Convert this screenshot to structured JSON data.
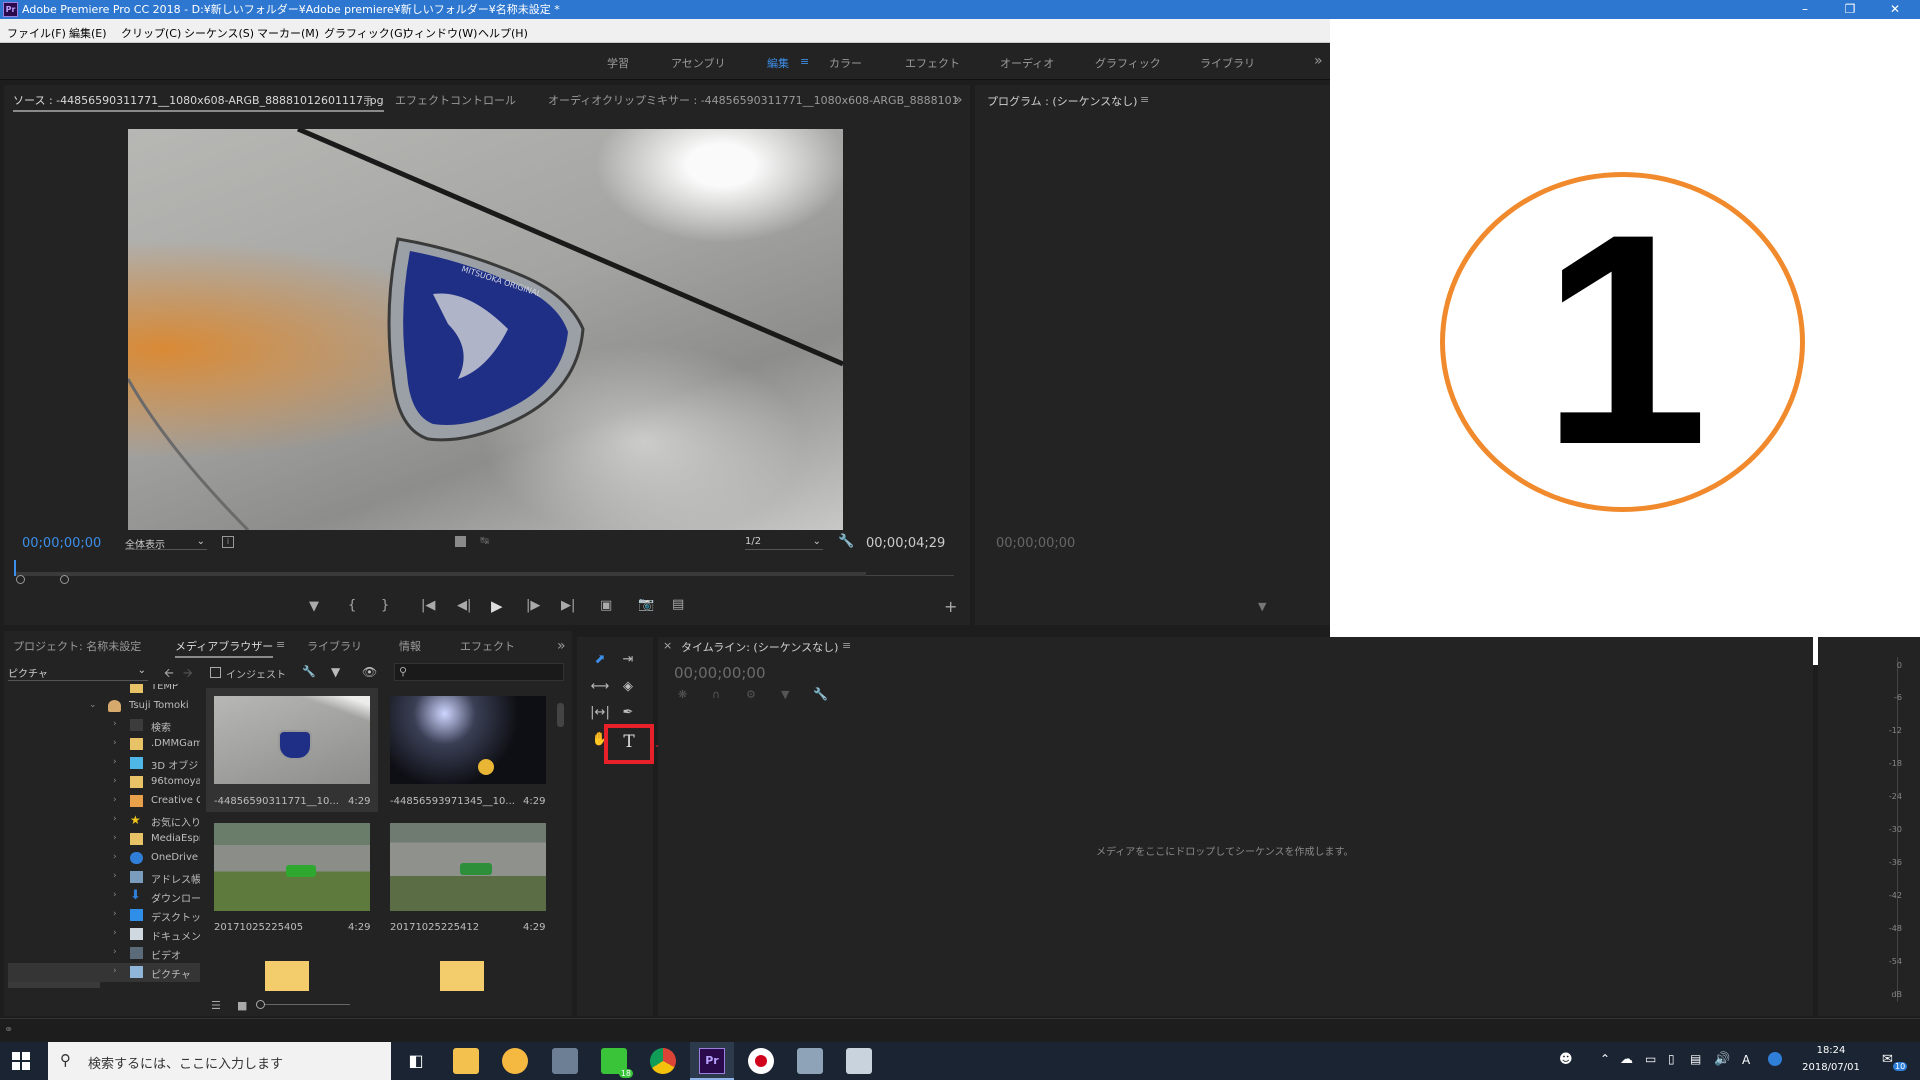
{
  "window": {
    "title": "Adobe Premiere Pro CC 2018 - D:¥新しいフォルダー¥Adobe premiere¥新しいフォルダー¥名称未設定 *",
    "app_icon": "Pr",
    "controls": [
      "minimize-icon",
      "restore-icon",
      "close-icon"
    ]
  },
  "menu": [
    "ファイル(F)",
    "編集(E)",
    "クリップ(C)",
    "シーケンス(S)",
    "マーカー(M)",
    "グラフィック(G)",
    "ウィンドウ(W)",
    "ヘルプ(H)"
  ],
  "workspaces": {
    "items": [
      "学習",
      "アセンブリ",
      "編集",
      "カラー",
      "エフェクト",
      "オーディオ",
      "グラフィック",
      "ライブラリ"
    ],
    "active": "編集",
    "overflow": "»"
  },
  "source_panel": {
    "tabs": [
      "ソース : -44856590311771__1080x608-ARGB_88881012601117.jpg",
      "エフェクトコントロール",
      "オーディオクリップミキサー : -44856590311771__1080x608-ARGB_8888101"
    ],
    "menu_icon": "≡",
    "timecode_in": "00;00;00;00",
    "zoom": "全体表示",
    "resolution": "1/2",
    "timecode_duration": "00;00;04;29",
    "badge_text": "MITSUOKA ORIGINAL",
    "add": "+"
  },
  "program_panel": {
    "title": "プログラム : (シーケンスなし)",
    "menu_icon": "≡",
    "timecode": "00;00;00;00"
  },
  "overlay": {
    "number": "1",
    "circle_color": "#f08a2c"
  },
  "project_panel": {
    "tabs": [
      "プロジェクト: 名称未設定",
      "メディアブラウザー",
      "ライブラリ",
      "情報",
      "エフェクト"
    ],
    "active_tab": "メディアブラウザー",
    "location": "ピクチャ",
    "ingest_label": "インジェスト",
    "search_placeholder": "",
    "tree_top": "TEMP",
    "user": "Tsuji Tomoki",
    "tree": [
      {
        "label": "検索",
        "icon": "search-folder-icon"
      },
      {
        "label": ".DMMGam",
        "icon": "folder-icon"
      },
      {
        "label": "3D オブジ",
        "icon": "3d-folder-icon"
      },
      {
        "label": "96tomoya",
        "icon": "folder-icon"
      },
      {
        "label": "Creative C",
        "icon": "creative-cloud-folder-icon"
      },
      {
        "label": "お気に入り",
        "icon": "star-icon"
      },
      {
        "label": "MediaEspr",
        "icon": "folder-icon"
      },
      {
        "label": "OneDrive",
        "icon": "onedrive-icon"
      },
      {
        "label": "アドレス帳",
        "icon": "contacts-icon"
      },
      {
        "label": "ダウンロー",
        "icon": "download-icon"
      },
      {
        "label": "デスクトッ",
        "icon": "desktop-icon"
      },
      {
        "label": "ドキュメン",
        "icon": "documents-icon"
      },
      {
        "label": "ビデオ",
        "icon": "video-folder-icon"
      },
      {
        "label": "ピクチャ",
        "icon": "pictures-folder-icon"
      }
    ],
    "thumbnails": [
      {
        "name": "-44856590311771__10...",
        "duration": "4:29"
      },
      {
        "name": "-44856593971345__10...",
        "duration": "4:29"
      },
      {
        "name": "20171025225405",
        "duration": "4:29"
      },
      {
        "name": "20171025225412",
        "duration": "4:29"
      }
    ]
  },
  "tools": [
    "selection-tool-icon",
    "track-select-tool-icon",
    "ripple-edit-tool-icon",
    "razor-tool-icon",
    "slip-tool-icon",
    "pen-tool-icon",
    "hand-tool-icon",
    "type-tool-icon"
  ],
  "type_tool_glyph": "T",
  "timeline_panel": {
    "title": "タイムライン: (シーケンスなし)",
    "close": "×",
    "menu_icon": "≡",
    "timecode": "00;00;00;00",
    "empty_message": "メディアをここにドロップしてシーケンスを作成します。"
  },
  "audio_meter": {
    "ticks": [
      "0",
      "-6",
      "-12",
      "-18",
      "-24",
      "-30",
      "-36",
      "-42",
      "-48",
      "-54",
      "dB"
    ]
  },
  "taskbar": {
    "search_placeholder": "検索するには、ここに入力します",
    "time": "18:24",
    "date": "2018/07/01",
    "ime": "A",
    "line_badge": "18",
    "notification_count": "10"
  },
  "annotation": {
    "arrow_color": "#e8202a",
    "highlight_color": "#e8202a"
  }
}
